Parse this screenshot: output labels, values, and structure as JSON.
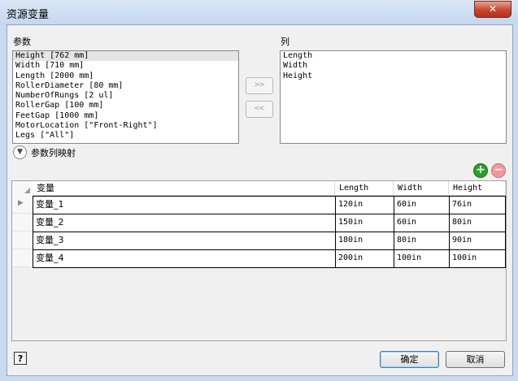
{
  "window": {
    "title": "资源变量",
    "close_glyph": "✕"
  },
  "params": {
    "label": "参数",
    "items": [
      "Height [762 mm]",
      "Width [710 mm]",
      "Length [2000 mm]",
      "RollerDiameter [80 mm]",
      "NumberOfRungs [2 ul]",
      "RollerGap [100 mm]",
      "FeetGap [1000 mm]",
      "MotorLocation [\"Front-Right\"]",
      "Legs [\"All\"]"
    ],
    "selected_index": 0
  },
  "columns": {
    "label": "列",
    "items": [
      "Length",
      "Width",
      "Height"
    ]
  },
  "move_buttons": {
    "add": ">>",
    "remove": "<<"
  },
  "mapping": {
    "label": "参数列映射",
    "expander_icon": "chevron-down-icon"
  },
  "grid_icons": {
    "add": "plus-icon",
    "remove": "minus-icon"
  },
  "grid": {
    "headers": [
      "变量",
      "Length",
      "Width",
      "Height"
    ],
    "rows": [
      [
        "变量_1",
        "120in",
        "60in",
        "76in"
      ],
      [
        "变量_2",
        "150in",
        "60in",
        "80in"
      ],
      [
        "变量_3",
        "180in",
        "80in",
        "90in"
      ],
      [
        "变量_4",
        "200in",
        "100in",
        "100in"
      ]
    ],
    "current_row_marker": "▶"
  },
  "footer": {
    "help_label": "?",
    "ok_label": "确定",
    "cancel_label": "取消"
  },
  "colors": {
    "frame": "#c9daf0",
    "close_button": "#c7452f",
    "add_icon": "#2e9e2e",
    "remove_icon": "#e88f8f"
  }
}
